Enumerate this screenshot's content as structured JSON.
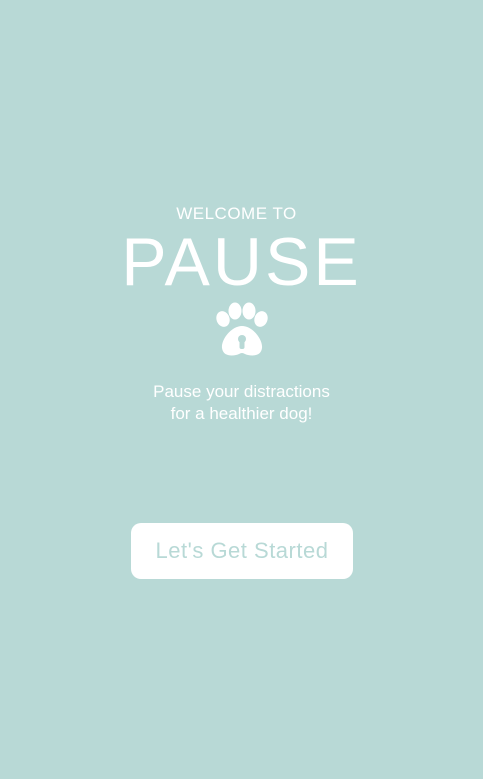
{
  "welcome": {
    "kicker": "WELCOME TO",
    "app_name": "PAUSE",
    "logo_icon": "paw-print-icon",
    "tagline_line1": "Pause your distractions",
    "tagline_line2": "for a healthier dog!",
    "start_button_label": "Let's Get Started"
  },
  "colors": {
    "background": "#b8d9d6",
    "text": "#ffffff",
    "button_bg": "#ffffff",
    "button_text": "#b8d9d6"
  }
}
